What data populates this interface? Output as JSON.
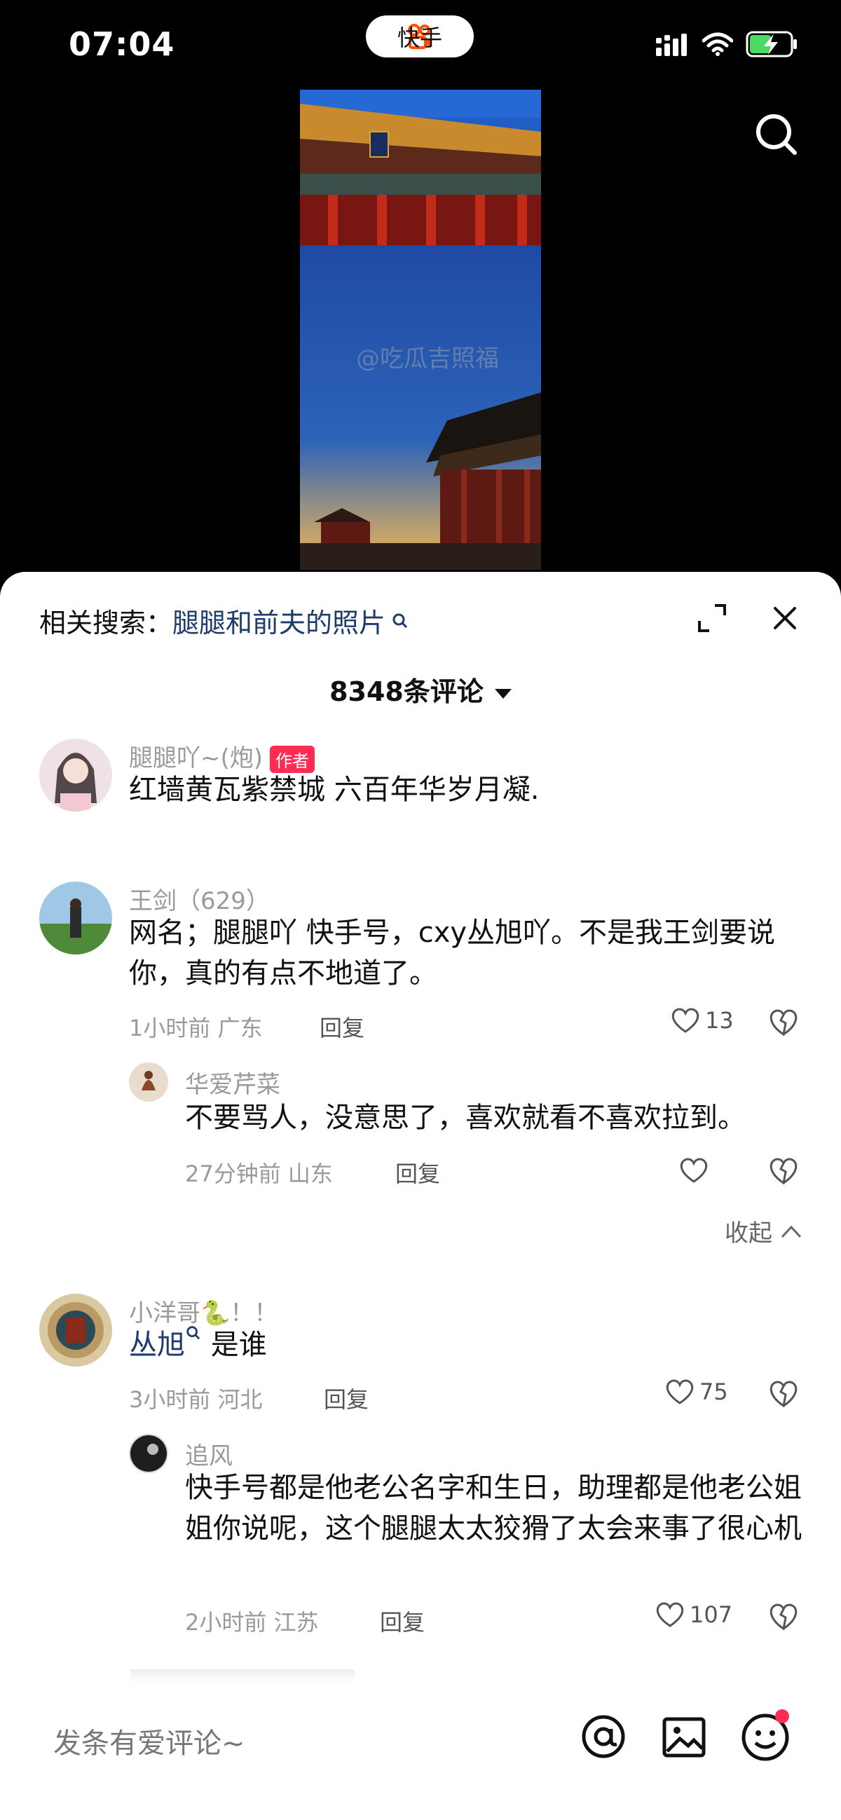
{
  "status_bar": {
    "time": "07:04",
    "app_name": "快手"
  },
  "related_search": {
    "label": "相关搜索：",
    "query": "腿腿和前夫的照片"
  },
  "comment_count": "8348条评论",
  "comments": [
    {
      "name": "腿腿吖~(炮)",
      "badge": "作者",
      "text": "红墙黄瓦紫禁城 六百年华岁月凝."
    },
    {
      "name": "王剑（629）",
      "text": "网名；腿腿吖 快手号，cxy丛旭吖。不是我王剑要说你，真的有点不地道了。",
      "time": "1小时前 广东",
      "reply": "回复",
      "likes": "13"
    },
    {
      "name": "华爱芹菜",
      "text": "不要骂人，没意思了，喜欢就看不喜欢拉到。",
      "time": "27分钟前 山东",
      "reply": "回复"
    },
    {
      "name": "小洋哥🐍！！",
      "text_link": "丛旭",
      "text_rest": "是谁",
      "time": "3小时前 河北",
      "reply": "回复",
      "likes": "75"
    },
    {
      "name": "追风",
      "text": "快手号都是他老公名字和生日，助理都是他老公姐姐你说呢，这个腿腿太太狡猾了太会来事了很心机",
      "time": "2小时前 江苏",
      "reply": "回复",
      "likes": "107"
    }
  ],
  "collapse_label": "收起",
  "watermark": "@吃瓜吉照福",
  "input_placeholder": "发条有爱评论~",
  "colors": {
    "accent": "#fe2c55",
    "link": "#1d3b6b"
  }
}
